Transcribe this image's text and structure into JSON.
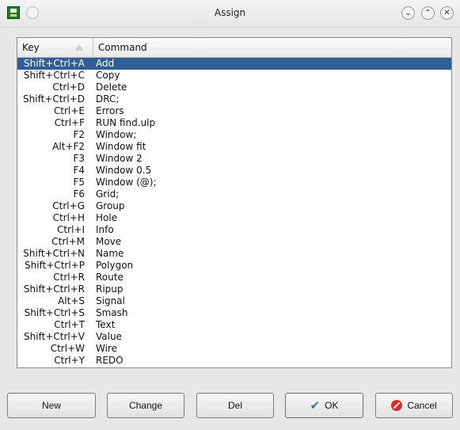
{
  "window": {
    "title": "Assign"
  },
  "table": {
    "columns": [
      "Key",
      "Command"
    ],
    "rows": [
      {
        "key": "Shift+Ctrl+A",
        "command": "Add",
        "selected": true
      },
      {
        "key": "Shift+Ctrl+C",
        "command": "Copy"
      },
      {
        "key": "Ctrl+D",
        "command": "Delete"
      },
      {
        "key": "Shift+Ctrl+D",
        "command": "DRC;"
      },
      {
        "key": "Ctrl+E",
        "command": "Errors"
      },
      {
        "key": "Ctrl+F",
        "command": "RUN find.ulp"
      },
      {
        "key": "F2",
        "command": "Window;"
      },
      {
        "key": "Alt+F2",
        "command": "Window fit"
      },
      {
        "key": "F3",
        "command": "Window 2"
      },
      {
        "key": "F4",
        "command": "Window 0.5"
      },
      {
        "key": "F5",
        "command": "Window (@);"
      },
      {
        "key": "F6",
        "command": "Grid;"
      },
      {
        "key": "Ctrl+G",
        "command": "Group"
      },
      {
        "key": "Ctrl+H",
        "command": "Hole"
      },
      {
        "key": "Ctrl+I",
        "command": "Info"
      },
      {
        "key": "Ctrl+M",
        "command": "Move"
      },
      {
        "key": "Shift+Ctrl+N",
        "command": "Name"
      },
      {
        "key": "Shift+Ctrl+P",
        "command": "Polygon"
      },
      {
        "key": "Ctrl+R",
        "command": "Route"
      },
      {
        "key": "Shift+Ctrl+R",
        "command": "Ripup"
      },
      {
        "key": "Alt+S",
        "command": "Signal"
      },
      {
        "key": "Shift+Ctrl+S",
        "command": "Smash"
      },
      {
        "key": "Ctrl+T",
        "command": "Text"
      },
      {
        "key": "Shift+Ctrl+V",
        "command": "Value"
      },
      {
        "key": "Ctrl+W",
        "command": "Wire"
      },
      {
        "key": "Ctrl+Y",
        "command": "REDO"
      }
    ]
  },
  "buttons": {
    "new": "New",
    "change": "Change",
    "del": "Del",
    "ok": "OK",
    "cancel": "Cancel"
  },
  "icons": {
    "app": "eagle-app-icon",
    "menu": "window-menu-icon",
    "minimize": "chevron-down-icon",
    "maximize": "chevron-up-icon",
    "close": "close-icon",
    "sort": "sort-ascending-icon",
    "ok": "checkmark-icon",
    "cancel": "cancel-icon"
  },
  "colors": {
    "selection": "#2f5f94",
    "window_bg": "#e7e7e7",
    "ok_icon": "#3f6fb3",
    "cancel_icon": "#d42d2d"
  }
}
